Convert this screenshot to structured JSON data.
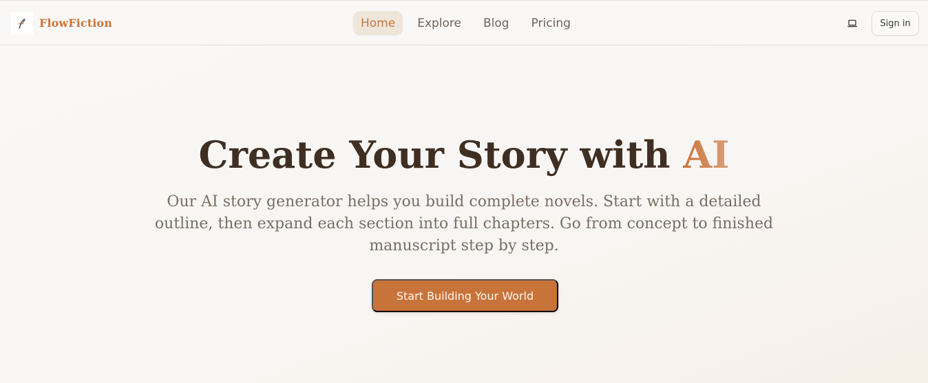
{
  "brand": {
    "name": "FlowFiction",
    "logo_icon": "quill-pen-icon",
    "color": "#c8743c"
  },
  "nav": {
    "items": [
      {
        "label": "Home",
        "active": true
      },
      {
        "label": "Explore",
        "active": false
      },
      {
        "label": "Blog",
        "active": false
      },
      {
        "label": "Pricing",
        "active": false
      }
    ]
  },
  "header_actions": {
    "theme_icon": "laptop-icon",
    "sign_in_label": "Sign in"
  },
  "hero": {
    "title_main": "Create Your Story with ",
    "title_accent": "AI",
    "subtitle": "Our AI story generator helps you build complete novels. Start with a detailed outline, then expand each section into full chapters. Go from concept to finished manuscript step by step.",
    "cta_label": "Start Building Your World"
  },
  "colors": {
    "accent": "#c8743c",
    "heading": "#3f2f22",
    "body_text": "#7a6d64",
    "background": "#f9f8f6",
    "nav_active_bg": "#efe6da"
  }
}
